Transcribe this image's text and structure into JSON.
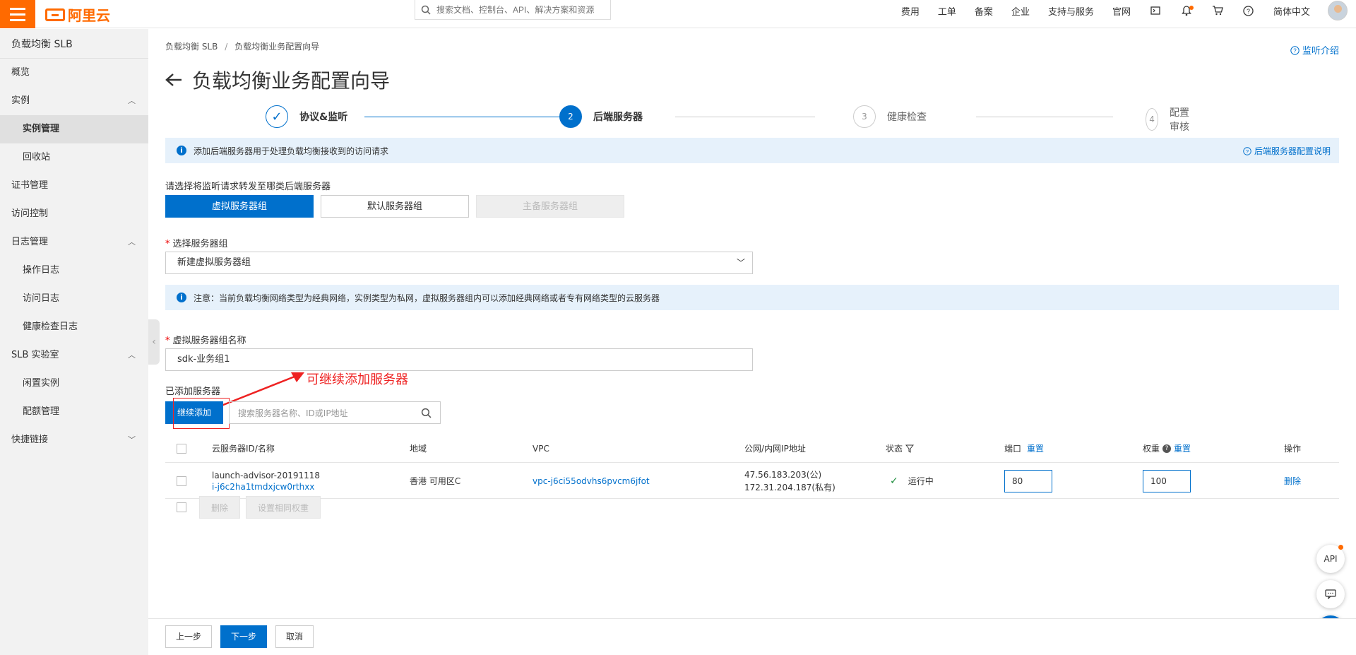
{
  "header": {
    "logo": "阿里云",
    "search_placeholder": "搜索文档、控制台、API、解决方案和资源",
    "links": [
      "费用",
      "工单",
      "备案",
      "企业",
      "支持与服务",
      "官网"
    ],
    "language": "简体中文"
  },
  "sidebar": {
    "title": "负载均衡 SLB",
    "items": [
      {
        "label": "概览"
      },
      {
        "label": "实例"
      },
      {
        "label": "实例管理"
      },
      {
        "label": "回收站"
      },
      {
        "label": "证书管理"
      },
      {
        "label": "访问控制"
      },
      {
        "label": "日志管理"
      },
      {
        "label": "操作日志"
      },
      {
        "label": "访问日志"
      },
      {
        "label": "健康检查日志"
      },
      {
        "label": "SLB 实验室"
      },
      {
        "label": "闲置实例"
      },
      {
        "label": "配额管理"
      },
      {
        "label": "快捷链接"
      }
    ]
  },
  "breadcrumb": {
    "root": "负载均衡 SLB",
    "sep": "/",
    "current": "负载均衡业务配置向导"
  },
  "help_link": "监听介绍",
  "page_title": "负载均衡业务配置向导",
  "steps": [
    {
      "num": "1",
      "label": "协议&监听"
    },
    {
      "num": "2",
      "label": "后端服务器"
    },
    {
      "num": "3",
      "label": "健康检查"
    },
    {
      "num": "4",
      "label": "配置审核"
    }
  ],
  "info1": {
    "text": "添加后端服务器用于处理负载均衡接收到的访问请求",
    "link": "后端服务器配置说明"
  },
  "forward_label": "请选择将监听请求转发至哪类后端服务器",
  "server_types": [
    "虚拟服务器组",
    "默认服务器组",
    "主备服务器组"
  ],
  "select_group": {
    "label": "选择服务器组",
    "value": "新建虚拟服务器组"
  },
  "info2": {
    "text": "注意：当前负载均衡网络类型为经典网络，实例类型为私网，虚拟服务器组内可以添加经典网络或者专有网络类型的云服务器"
  },
  "group_name": {
    "label": "虚拟服务器组名称",
    "value": "sdk-业务组1"
  },
  "added_label": "已添加服务器",
  "annotation": "可继续添加服务器",
  "add_button": "继续添加",
  "table_search_placeholder": "搜索服务器名称、ID或IP地址",
  "table": {
    "headers": {
      "id": "云服务器ID/名称",
      "region": "地域",
      "vpc": "VPC",
      "ip": "公网/内网IP地址",
      "status": "状态",
      "port": "端口",
      "weight": "权重",
      "op": "操作",
      "reset": "重置"
    },
    "rows": [
      {
        "name": "launch-advisor-20191118",
        "id": "i-j6c2ha1tmdxjcw0rthxx",
        "region": "香港 可用区C",
        "vpc": "vpc-j6ci55odvhs6pvcm6jfot",
        "ip_public": "47.56.183.203(公)",
        "ip_private": "172.31.204.187(私有)",
        "status": "运行中",
        "port": "80",
        "weight": "100",
        "op": "删除"
      }
    ]
  },
  "bulk": {
    "delete": "删除",
    "set_weight": "设置相同权重"
  },
  "footer": {
    "prev": "上一步",
    "next": "下一步",
    "cancel": "取消"
  },
  "floating": {
    "api": "API"
  }
}
